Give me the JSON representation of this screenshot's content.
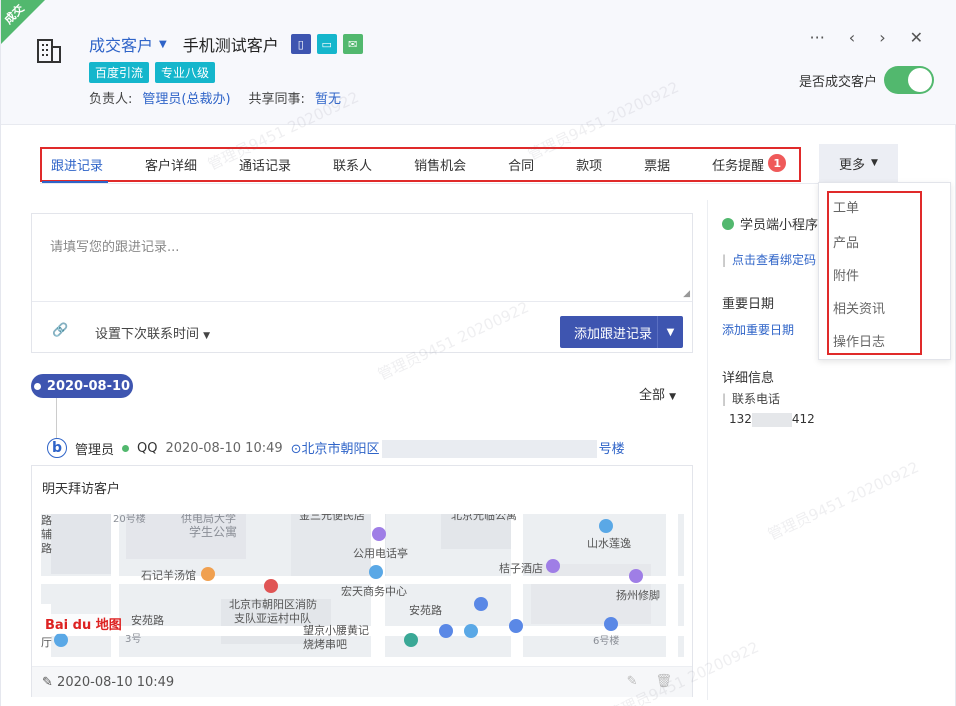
{
  "header": {
    "corner_badge": "成交",
    "status": "成交客户",
    "customer_name": "手机测试客户",
    "channels": [
      {
        "icon": "phone-icon",
        "color": "#3e55b0",
        "glyph": "▯"
      },
      {
        "icon": "chat-icon",
        "color": "#15b6cc",
        "glyph": "▭"
      },
      {
        "icon": "mail-icon",
        "color": "#52b86e",
        "glyph": "✉"
      }
    ],
    "tags": [
      "百度引流",
      "专业八级"
    ],
    "owner_label": "负责人:",
    "owner_value": "管理员(总裁办)",
    "shared_label": "共享同事:",
    "shared_value": "暂无",
    "deal_label": "是否成交客户",
    "deal_on": true,
    "controls": {
      "more": "···",
      "prev": "‹",
      "next": "›",
      "close": "✕"
    }
  },
  "tabs": {
    "items": [
      "跟进记录",
      "客户详细",
      "通话记录",
      "联系人",
      "销售机会",
      "合同",
      "款项",
      "票据",
      "任务提醒"
    ],
    "active_index": 0,
    "task_badge": "1",
    "more_label": "更多"
  },
  "more_menu": [
    "工单",
    "产品",
    "附件",
    "相关资讯",
    "操作日志"
  ],
  "editor": {
    "placeholder": "请填写您的跟进记录...",
    "next_contact": "设置下次联系时间",
    "add_button": "添加跟进记录"
  },
  "timeline": {
    "date": "2020-08-10",
    "filter": "全部",
    "record": {
      "user": "管理员",
      "channel": "QQ",
      "time": "2020-08-10 10:49",
      "location_prefix": "北京市朝阳区",
      "location_suffix": "号楼",
      "note": "明天拜访客户",
      "footer_time": "2020-08-10 10:49"
    },
    "map_labels": [
      "20号楼",
      "供电局大学",
      "学生公寓",
      "金三元便民店",
      "北京光临公寓",
      "山水莲逸",
      "公用电话亭",
      "桔子酒店",
      "石记羊汤馆",
      "宏天商务中心",
      "扬州修脚",
      "北京市朝阳区消防",
      "支队亚运村中队",
      "安苑路",
      "安苑路",
      "望京小腰黄记",
      "烧烤串吧",
      "6号楼",
      "3号",
      "路",
      "辅",
      "路",
      "厅"
    ],
    "map_brand": "Bai du 地图"
  },
  "right_panel": {
    "mini_program": "学员端小程序",
    "bind_link": "点击查看绑定码",
    "important_dates": "重要日期",
    "add_important": "添加重要日期",
    "detail_info": "详细信息",
    "phone_label": "联系电话",
    "phone_prefix": "132",
    "phone_suffix": "412"
  },
  "watermark": "管理员9451 20200922"
}
